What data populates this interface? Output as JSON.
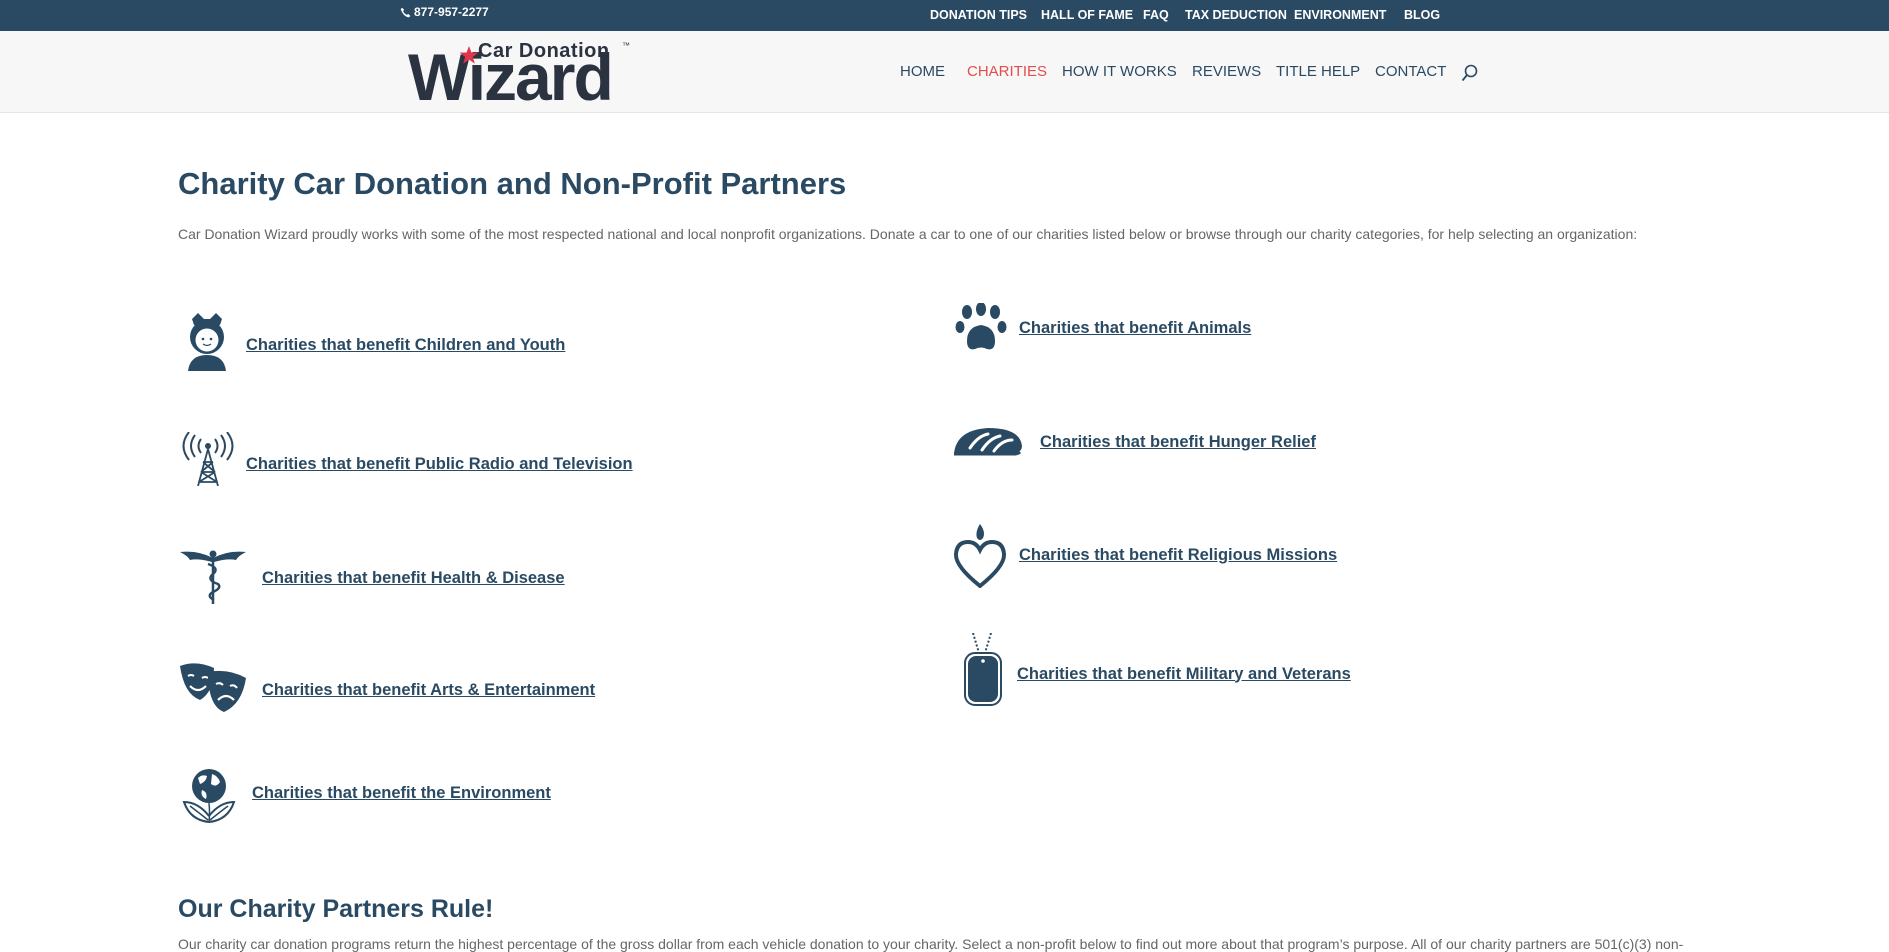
{
  "topbar": {
    "phone": "877-957-2277",
    "links": [
      "DONATION TIPS",
      "HALL OF FAME",
      "FAQ",
      "TAX DEDUCTION",
      "ENVIRONMENT",
      "BLOG"
    ]
  },
  "logo": {
    "small": "Car Donation",
    "big": "Wizard",
    "tm": "™"
  },
  "nav": {
    "items": [
      "HOME",
      "CHARITIES",
      "HOW IT WORKS",
      "REVIEWS",
      "TITLE HELP",
      "CONTACT"
    ],
    "active": "CHARITIES"
  },
  "main": {
    "title": "Charity Car Donation and Non-Profit Partners",
    "intro": "Car Donation Wizard proudly works with some of the most respected national and local nonprofit organizations. Donate a car to one of our charities listed below or browse through our charity categories, for help selecting an organization:",
    "categories": [
      {
        "label": "Charities that benefit Children and Youth",
        "icon": "girl-icon"
      },
      {
        "label": "Charities that benefit Public Radio and Television",
        "icon": "radio-tower-icon"
      },
      {
        "label": "Charities that benefit Health & Disease",
        "icon": "caduceus-icon"
      },
      {
        "label": "Charities that benefit Arts & Entertainment",
        "icon": "theater-masks-icon"
      },
      {
        "label": "Charities that benefit the Environment",
        "icon": "globe-leaf-icon"
      },
      {
        "label": "Charities that benefit Animals",
        "icon": "paw-icon"
      },
      {
        "label": "Charities that benefit Hunger Relief",
        "icon": "bread-icon"
      },
      {
        "label": "Charities that benefit Religious Missions",
        "icon": "heart-flame-icon"
      },
      {
        "label": "Charities that benefit Military and Veterans",
        "icon": "dog-tag-icon"
      }
    ],
    "partners_title": "Our Charity Partners Rule!",
    "partners_text": "Our charity car donation programs return the highest percentage of the gross dollar from each vehicle donation to your charity. Select a non-profit below to find out more about that program’s purpose. All of our charity partners are 501(c)(3) non-"
  },
  "colors": {
    "topbar": "#2a4a63",
    "accent": "#e04e4e",
    "link": "#2a4a63"
  }
}
